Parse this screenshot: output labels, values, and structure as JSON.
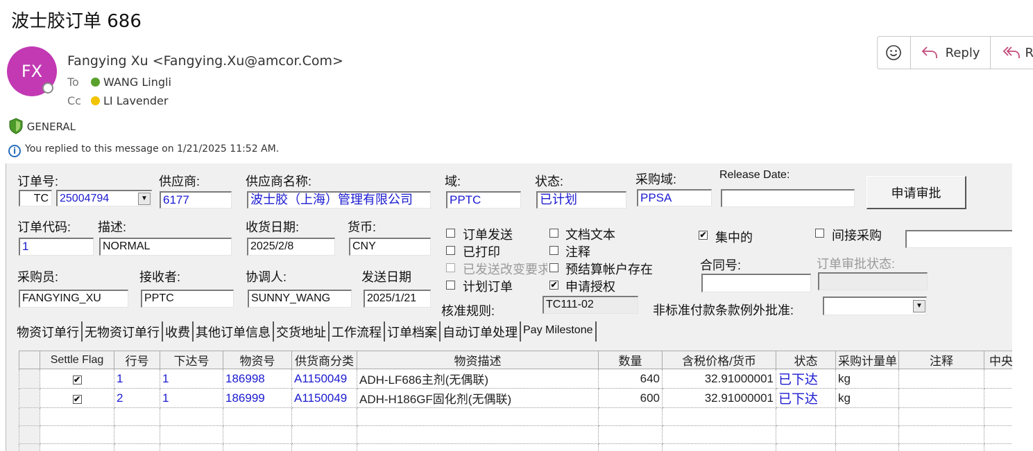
{
  "email": {
    "subject": "波士胶订单  686",
    "avatar_initials": "FX",
    "avatar_color": "#c239b3",
    "from": "Fangying Xu <Fangying.Xu@amcor.Com>",
    "to_label": "To",
    "to": "WANG Lingli",
    "cc_label": "Cc",
    "cc": "LI Lavender",
    "sensitivity": "GENERAL",
    "replied_notice": "You replied to this message on 1/21/2025 11:52 AM.",
    "actions": {
      "emoji_icon": "smiley-icon",
      "reply": "Reply",
      "reply_all": "R"
    }
  },
  "form": {
    "order_no_label": "订单号:",
    "order_type": "TC",
    "order_no": "25004794",
    "supplier_label": "供应商:",
    "supplier": "6177",
    "supplier_name_label": "供应商名称:",
    "supplier_name": "波士胶（上海）管理有限公司",
    "domain_label": "域:",
    "domain": "PPTC",
    "status_label": "状态:",
    "status": "已计划",
    "purchase_domain_label": "采购域:",
    "purchase_domain": "PPSA",
    "release_date_label": "Release Date:",
    "release_date": "",
    "submit_button": "申请审批",
    "order_code_label": "订单代码:",
    "order_code": "1",
    "desc_label": "描述:",
    "desc": "NORMAL",
    "receive_date_label": "收货日期:",
    "receive_date": "2025/2/8",
    "currency_label": "货币:",
    "currency": "CNY",
    "buyer_label": "采购员:",
    "buyer": "FANGYING_XU",
    "receiver_label": "接收者:",
    "receiver": "PPTC",
    "coordinator_label": "协调人:",
    "coordinator": "SUNNY_WANG",
    "send_date_label": "发送日期",
    "send_date": "2025/1/21",
    "checkboxes": {
      "order_send": "订单发送",
      "printed": "已打印",
      "change_sent": "已发送改变要求",
      "planned_order": "计划订单",
      "doc_text": "文档文本",
      "note": "注释",
      "prepay_account": "预结算帐户存在",
      "apply_auth": "申请授权",
      "centralized": "集中的",
      "indirect": "间接采购"
    },
    "approval_rule_label": "核准规则:",
    "approval_rule": "TC111-02",
    "contract_label": "合同号:",
    "contract": "",
    "order_approval_status_label": "订单审批状态:",
    "order_approval_status": "",
    "nonstd_payment_label": "非标准付款条款例外批准:",
    "nonstd_payment": ""
  },
  "tabs": [
    "物资订单行",
    "无物资订单行",
    "收费",
    "其他订单信息",
    "交货地址",
    "工作流程",
    "订单档案",
    "自动订单处理",
    "Pay Milestone"
  ],
  "grid": {
    "columns": [
      "",
      "Settle Flag",
      "行号",
      "下达号",
      "物资号",
      "供货商分类",
      "物资描述",
      "数量",
      "含税价格/货币",
      "状态",
      "采购计量单",
      "注释",
      "中央"
    ],
    "rows": [
      {
        "settle": "✔",
        "line": "1",
        "release": "1",
        "item": "186998",
        "vendor_class": "A1150049",
        "desc": "ADH-LF686主剂(无偶联)",
        "qty": "640",
        "price": "32.91000001",
        "status": "已下达",
        "uom": "kg",
        "note": "",
        "central": ""
      },
      {
        "settle": "✔",
        "line": "2",
        "release": "1",
        "item": "186999",
        "vendor_class": "A1150049",
        "desc": "ADH-H186GF固化剂(无偶联)",
        "qty": "600",
        "price": "32.91000001",
        "status": "已下达",
        "uom": "kg",
        "note": "",
        "central": ""
      }
    ]
  },
  "colors": {
    "accent_blue": "#1a1ad0",
    "form_bg": "#f0f0f0",
    "avatar": "#c239b3"
  }
}
